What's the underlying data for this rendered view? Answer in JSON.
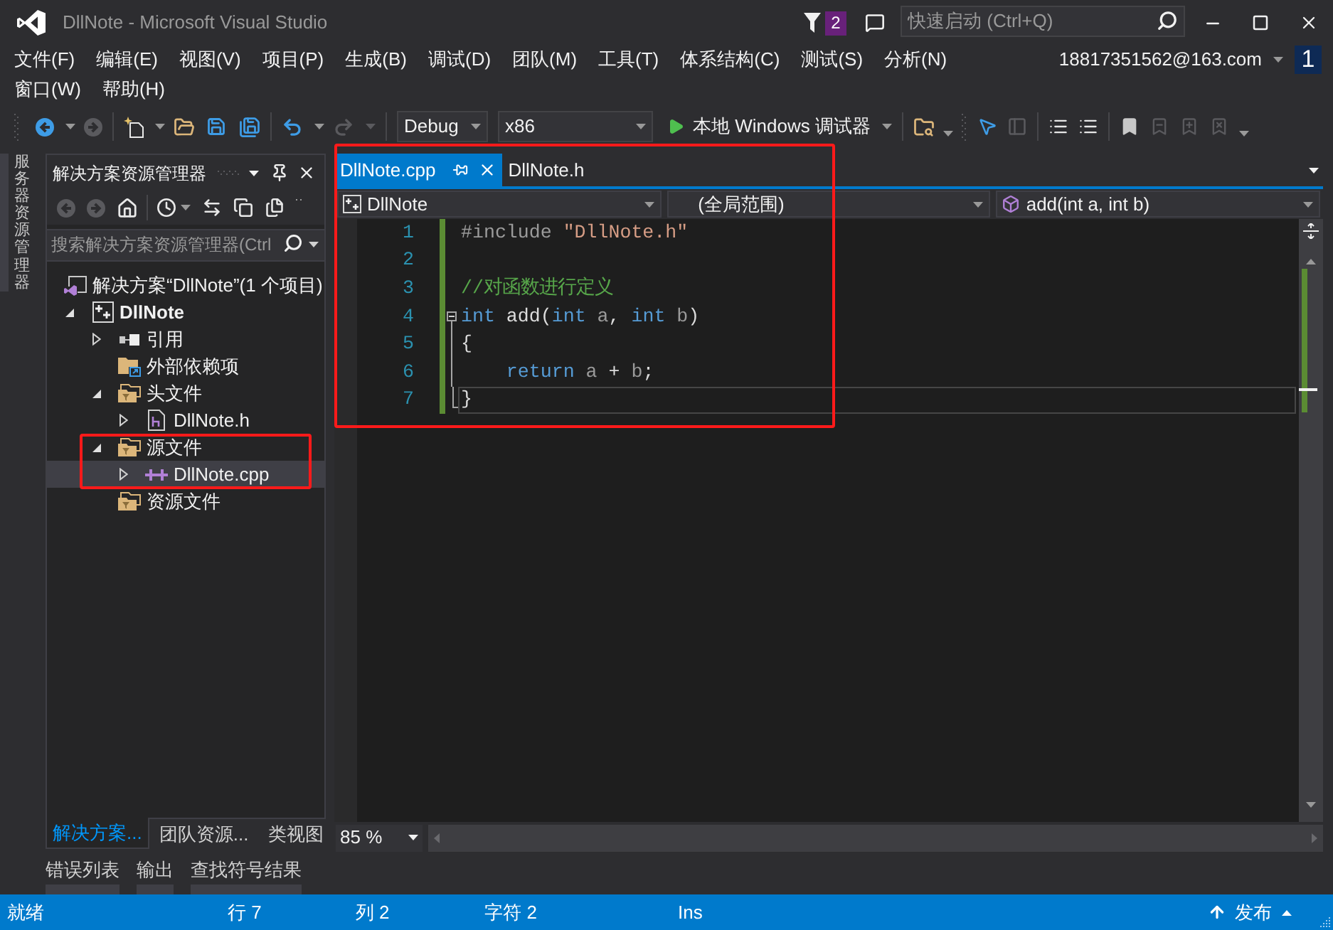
{
  "window": {
    "title": "DllNote - Microsoft Visual Studio",
    "notification_count": "2",
    "quick_launch": {
      "placeholder": "快速启动 (Ctrl+Q)"
    }
  },
  "menu": {
    "rows": [
      [
        "文件(F)",
        "编辑(E)",
        "视图(V)",
        "项目(P)",
        "生成(B)",
        "调试(D)",
        "团队(M)",
        "工具(T)",
        "体系结构(C)",
        "测试(S)",
        "分析(N)"
      ],
      [
        "窗口(W)",
        "帮助(H)"
      ]
    ],
    "account": "18817351562@163.com",
    "account_badge": "1"
  },
  "toolbar": {
    "configuration": "Debug",
    "platform": "x86",
    "run_label": "本地 Windows 调试器"
  },
  "side_tabs": [
    "服务器资源管理器"
  ],
  "solution_explorer": {
    "title": "解决方案资源管理器",
    "search_placeholder": "搜索解决方案资源管理器(Ctrl",
    "tree": [
      {
        "label": "解决方案“DllNote”(1 个项目)",
        "kind": "solution",
        "selected": false,
        "highlighted": false,
        "children": [
          {
            "label": "DllNote",
            "kind": "project",
            "expanded": true,
            "selected": false,
            "highlighted": false,
            "children": [
              {
                "label": "引用",
                "kind": "references",
                "expanded": false,
                "selected": false,
                "highlighted": false
              },
              {
                "label": "外部依赖项",
                "kind": "external",
                "selected": false,
                "highlighted": false
              },
              {
                "label": "头文件",
                "kind": "filter",
                "expanded": true,
                "selected": false,
                "highlighted": false,
                "children": [
                  {
                    "label": "DllNote.h",
                    "kind": "header",
                    "expanded": false,
                    "selected": false,
                    "highlighted": false
                  }
                ]
              },
              {
                "label": "源文件",
                "kind": "filter",
                "expanded": true,
                "selected": false,
                "highlighted": true,
                "children": [
                  {
                    "label": "DllNote.cpp",
                    "kind": "source",
                    "expanded": false,
                    "selected": true,
                    "highlighted": false
                  }
                ]
              },
              {
                "label": "资源文件",
                "kind": "filter",
                "selected": false,
                "highlighted": false
              }
            ]
          }
        ]
      }
    ],
    "tabs": [
      {
        "label": "解决方案...",
        "selected": true
      },
      {
        "label": "团队资源...",
        "selected": false
      },
      {
        "label": "类视图",
        "selected": false
      }
    ]
  },
  "editor": {
    "highlighted": true,
    "tabs": [
      {
        "label": "DllNote.cpp",
        "selected": true
      },
      {
        "label": "DllNote.h",
        "selected": false
      }
    ],
    "navigation": [
      {
        "label": "DllNote",
        "kind": "project"
      },
      {
        "label": "(全局范围)",
        "kind": "scope"
      },
      {
        "label": "add(int a, int b)",
        "kind": "function"
      }
    ],
    "lines": [
      {
        "number": "1",
        "modified": true,
        "current": false,
        "tokens": [
          {
            "text": "#include ",
            "kind": "preprocessor"
          },
          {
            "text": "\"DllNote.h\"",
            "kind": "string"
          }
        ]
      },
      {
        "number": "2",
        "modified": true,
        "current": false
      },
      {
        "number": "3",
        "modified": true,
        "current": false,
        "tokens": [
          {
            "text": "//对函数进行定义",
            "kind": "comment"
          }
        ]
      },
      {
        "number": "4",
        "modified": true,
        "current": false,
        "outline": {
          "kind": "start"
        },
        "tokens": [
          {
            "text": "int",
            "kind": "keyword"
          },
          {
            "text": " add(",
            "kind": "plain"
          },
          {
            "text": "int",
            "kind": "keyword"
          },
          {
            "text": " a",
            "kind": "param"
          },
          {
            "text": ", ",
            "kind": "plain"
          },
          {
            "text": "int",
            "kind": "keyword"
          },
          {
            "text": " b",
            "kind": "param"
          },
          {
            "text": ")",
            "kind": "plain"
          }
        ]
      },
      {
        "number": "5",
        "modified": true,
        "current": false,
        "outline": {
          "kind": "inside"
        },
        "tokens": [
          {
            "text": "{",
            "kind": "plain"
          }
        ]
      },
      {
        "number": "6",
        "modified": true,
        "current": false,
        "outline": {
          "kind": "inside"
        },
        "tokens": [
          {
            "text": "    return",
            "kind": "keyword"
          },
          {
            "text": " a",
            "kind": "param"
          },
          {
            "text": " + ",
            "kind": "plain"
          },
          {
            "text": "b",
            "kind": "param"
          },
          {
            "text": ";",
            "kind": "plain"
          }
        ]
      },
      {
        "number": "7",
        "modified": true,
        "current": true,
        "outline": {
          "kind": "end"
        },
        "tokens": [
          {
            "text": "}",
            "kind": "plain"
          }
        ]
      }
    ],
    "zoom": "85 %"
  },
  "tool_tabs": [
    "错误列表",
    "输出",
    "查找符号结果"
  ],
  "status_bar": {
    "message": "就绪",
    "line": "行 7",
    "column": "列 2",
    "character": "字符 2",
    "mode": "Ins",
    "publish": "发布"
  }
}
